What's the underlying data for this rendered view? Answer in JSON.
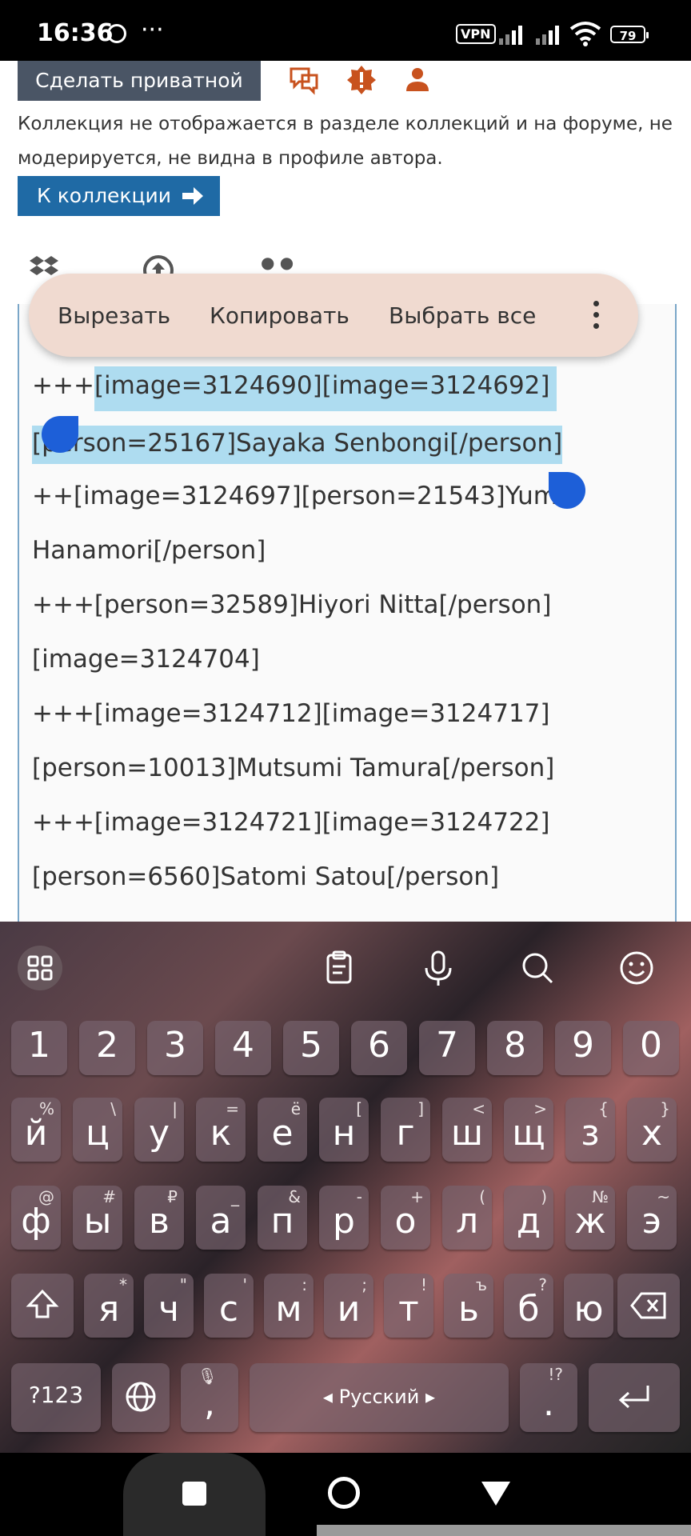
{
  "status_bar": {
    "time": "16:36",
    "dots": "···",
    "vpn": "VPN",
    "battery": "79"
  },
  "page": {
    "private_button": "Сделать приватной",
    "description": "Коллекция не отображается в разделе коллекций и на форуме, не модерируется, не видна в профиле автора.",
    "collection_button": "К коллекции"
  },
  "context_menu": {
    "cut": "Вырезать",
    "copy": "Копировать",
    "select_all": "Выбрать все"
  },
  "editor": {
    "lines": [
      {
        "prefix": "+++",
        "selected": "[image=3124690][image=3124692]"
      },
      {
        "prefix": "",
        "selected": "[person=25167]Sayaka Senbongi[/person]"
      },
      {
        "text": "++[image=3124697][person=21543]Yumiri"
      },
      {
        "text": "Hanamori[/person]"
      },
      {
        "text": "+++[person=32589]Hiyori Nitta[/person]"
      },
      {
        "text": "[image=3124704]"
      },
      {
        "text": "+++[image=3124712][image=3124717]"
      },
      {
        "text": "[person=10013]Mutsumi Tamura[/person]"
      },
      {
        "text": "+++[image=3124721][image=3124722]"
      },
      {
        "text": "[person=6560]Satomi Satou[/person]"
      }
    ]
  },
  "keyboard": {
    "numbers": [
      "1",
      "2",
      "3",
      "4",
      "5",
      "6",
      "7",
      "8",
      "9",
      "0"
    ],
    "row1": [
      {
        "k": "й",
        "a": "%"
      },
      {
        "k": "ц",
        "a": "\\"
      },
      {
        "k": "у",
        "a": "|"
      },
      {
        "k": "к",
        "a": "="
      },
      {
        "k": "е",
        "a": "ё"
      },
      {
        "k": "н",
        "a": "["
      },
      {
        "k": "г",
        "a": "]"
      },
      {
        "k": "ш",
        "a": "<"
      },
      {
        "k": "щ",
        "a": ">"
      },
      {
        "k": "з",
        "a": "{"
      },
      {
        "k": "х",
        "a": "}"
      }
    ],
    "row2": [
      {
        "k": "ф",
        "a": "@"
      },
      {
        "k": "ы",
        "a": "#"
      },
      {
        "k": "в",
        "a": "₽"
      },
      {
        "k": "а",
        "a": "_"
      },
      {
        "k": "п",
        "a": "&"
      },
      {
        "k": "р",
        "a": "-"
      },
      {
        "k": "о",
        "a": "+"
      },
      {
        "k": "л",
        "a": "("
      },
      {
        "k": "д",
        "a": ")"
      },
      {
        "k": "ж",
        "a": "№"
      },
      {
        "k": "э",
        "a": "~"
      }
    ],
    "row3": [
      {
        "k": "я",
        "a": "*"
      },
      {
        "k": "ч",
        "a": "\""
      },
      {
        "k": "с",
        "a": "'"
      },
      {
        "k": "м",
        "a": ":"
      },
      {
        "k": "и",
        "a": ";"
      },
      {
        "k": "т",
        "a": "!"
      },
      {
        "k": "ь",
        "a": "ъ"
      },
      {
        "k": "б",
        "a": "?"
      },
      {
        "k": "ю",
        "a": ""
      }
    ],
    "symbols_key": "?123",
    "comma": ",",
    "space_label": "Русский",
    "period": ".",
    "period_alt": "!?"
  }
}
